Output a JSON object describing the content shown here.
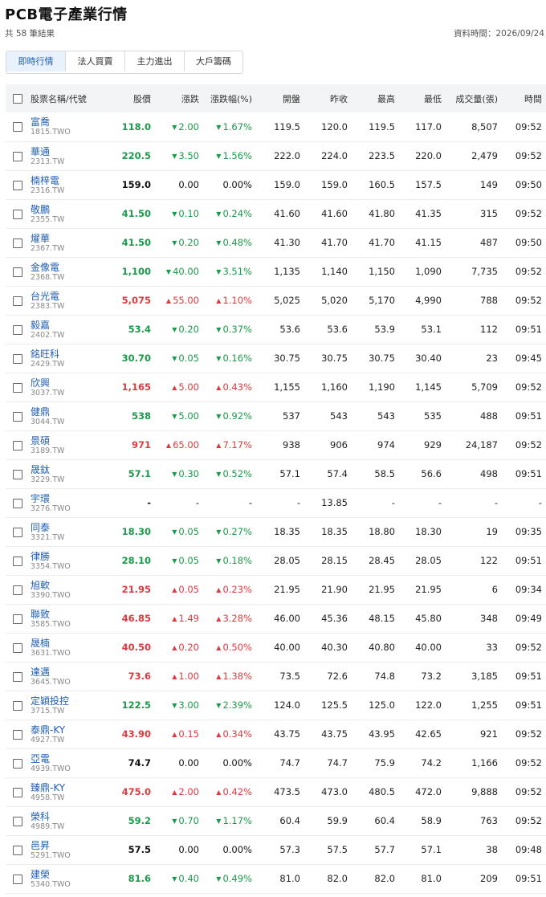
{
  "header": {
    "title": "PCB電子產業行情",
    "result_count": "共 58 筆結果",
    "data_time": "資料時間：2026/09/24"
  },
  "tabs": [
    {
      "label": "即時行情",
      "active": true
    },
    {
      "label": "法人買賣",
      "active": false
    },
    {
      "label": "主力進出",
      "active": false
    },
    {
      "label": "大戶籌碼",
      "active": false
    }
  ],
  "table": {
    "columns": [
      "股票名稱/代號",
      "股價",
      "漲跌",
      "漲跌幅(%)",
      "開盤",
      "昨收",
      "最高",
      "最低",
      "成交量(張)",
      "時間"
    ],
    "rows": [
      {
        "name": "富喬",
        "code": "1815.TWO",
        "price": "118.0",
        "change": "2.00",
        "pct": "1.67%",
        "open": "119.5",
        "prev": "120.0",
        "high": "119.5",
        "low": "117.0",
        "volume": "8,507",
        "time": "09:52",
        "dir": "down"
      },
      {
        "name": "華通",
        "code": "2313.TW",
        "price": "220.5",
        "change": "3.50",
        "pct": "1.56%",
        "open": "222.0",
        "prev": "224.0",
        "high": "223.5",
        "low": "220.0",
        "volume": "2,479",
        "time": "09:52",
        "dir": "down"
      },
      {
        "name": "楠梓電",
        "code": "2316.TW",
        "price": "159.0",
        "change": "0.00",
        "pct": "0.00%",
        "open": "159.0",
        "prev": "159.0",
        "high": "160.5",
        "low": "157.5",
        "volume": "149",
        "time": "09:50",
        "dir": "flat"
      },
      {
        "name": "敬鵬",
        "code": "2355.TW",
        "price": "41.50",
        "change": "0.10",
        "pct": "0.24%",
        "open": "41.60",
        "prev": "41.60",
        "high": "41.80",
        "low": "41.35",
        "volume": "315",
        "time": "09:52",
        "dir": "down"
      },
      {
        "name": "燿華",
        "code": "2367.TW",
        "price": "41.50",
        "change": "0.20",
        "pct": "0.48%",
        "open": "41.30",
        "prev": "41.70",
        "high": "41.70",
        "low": "41.15",
        "volume": "487",
        "time": "09:50",
        "dir": "down"
      },
      {
        "name": "金像電",
        "code": "2368.TW",
        "price": "1,100",
        "change": "40.00",
        "pct": "3.51%",
        "open": "1,135",
        "prev": "1,140",
        "high": "1,150",
        "low": "1,090",
        "volume": "7,735",
        "time": "09:52",
        "dir": "down"
      },
      {
        "name": "台光電",
        "code": "2383.TW",
        "price": "5,075",
        "change": "55.00",
        "pct": "1.10%",
        "open": "5,025",
        "prev": "5,020",
        "high": "5,170",
        "low": "4,990",
        "volume": "788",
        "time": "09:52",
        "dir": "up"
      },
      {
        "name": "毅嘉",
        "code": "2402.TW",
        "price": "53.4",
        "change": "0.20",
        "pct": "0.37%",
        "open": "53.6",
        "prev": "53.6",
        "high": "53.9",
        "low": "53.1",
        "volume": "112",
        "time": "09:51",
        "dir": "down"
      },
      {
        "name": "銘旺科",
        "code": "2429.TW",
        "price": "30.70",
        "change": "0.05",
        "pct": "0.16%",
        "open": "30.75",
        "prev": "30.75",
        "high": "30.75",
        "low": "30.40",
        "volume": "23",
        "time": "09:45",
        "dir": "down"
      },
      {
        "name": "欣興",
        "code": "3037.TW",
        "price": "1,165",
        "change": "5.00",
        "pct": "0.43%",
        "open": "1,155",
        "prev": "1,160",
        "high": "1,190",
        "low": "1,145",
        "volume": "5,709",
        "time": "09:52",
        "dir": "up"
      },
      {
        "name": "健鼎",
        "code": "3044.TW",
        "price": "538",
        "change": "5.00",
        "pct": "0.92%",
        "open": "537",
        "prev": "543",
        "high": "543",
        "low": "535",
        "volume": "488",
        "time": "09:51",
        "dir": "down"
      },
      {
        "name": "景碩",
        "code": "3189.TW",
        "price": "971",
        "change": "65.00",
        "pct": "7.17%",
        "open": "938",
        "prev": "906",
        "high": "974",
        "low": "929",
        "volume": "24,187",
        "time": "09:52",
        "dir": "up"
      },
      {
        "name": "晟鈦",
        "code": "3229.TW",
        "price": "57.1",
        "change": "0.30",
        "pct": "0.52%",
        "open": "57.1",
        "prev": "57.4",
        "high": "58.5",
        "low": "56.6",
        "volume": "498",
        "time": "09:51",
        "dir": "down"
      },
      {
        "name": "宇環",
        "code": "3276.TWO",
        "price": "-",
        "change": "-",
        "pct": "-",
        "open": "-",
        "prev": "13.85",
        "high": "-",
        "low": "-",
        "volume": "-",
        "time": "-",
        "dir": "none"
      },
      {
        "name": "同泰",
        "code": "3321.TW",
        "price": "18.30",
        "change": "0.05",
        "pct": "0.27%",
        "open": "18.35",
        "prev": "18.35",
        "high": "18.80",
        "low": "18.30",
        "volume": "19",
        "time": "09:35",
        "dir": "down"
      },
      {
        "name": "律勝",
        "code": "3354.TWO",
        "price": "28.10",
        "change": "0.05",
        "pct": "0.18%",
        "open": "28.05",
        "prev": "28.15",
        "high": "28.45",
        "low": "28.05",
        "volume": "122",
        "time": "09:51",
        "dir": "down"
      },
      {
        "name": "旭軟",
        "code": "3390.TWO",
        "price": "21.95",
        "change": "0.05",
        "pct": "0.23%",
        "open": "21.95",
        "prev": "21.90",
        "high": "21.95",
        "low": "21.95",
        "volume": "6",
        "time": "09:34",
        "dir": "up"
      },
      {
        "name": "聯致",
        "code": "3585.TWO",
        "price": "46.85",
        "change": "1.49",
        "pct": "3.28%",
        "open": "46.00",
        "prev": "45.36",
        "high": "48.15",
        "low": "45.80",
        "volume": "348",
        "time": "09:49",
        "dir": "up"
      },
      {
        "name": "晟楠",
        "code": "3631.TWO",
        "price": "40.50",
        "change": "0.20",
        "pct": "0.50%",
        "open": "40.00",
        "prev": "40.30",
        "high": "40.80",
        "low": "40.00",
        "volume": "33",
        "time": "09:52",
        "dir": "up"
      },
      {
        "name": "達邁",
        "code": "3645.TWO",
        "price": "73.6",
        "change": "1.00",
        "pct": "1.38%",
        "open": "73.5",
        "prev": "72.6",
        "high": "74.8",
        "low": "73.2",
        "volume": "3,185",
        "time": "09:51",
        "dir": "up"
      },
      {
        "name": "定穎投控",
        "code": "3715.TW",
        "price": "122.5",
        "change": "3.00",
        "pct": "2.39%",
        "open": "124.0",
        "prev": "125.5",
        "high": "125.0",
        "low": "122.0",
        "volume": "1,255",
        "time": "09:51",
        "dir": "down"
      },
      {
        "name": "泰鼎-KY",
        "code": "4927.TW",
        "price": "43.90",
        "change": "0.15",
        "pct": "0.34%",
        "open": "43.75",
        "prev": "43.75",
        "high": "43.95",
        "low": "42.65",
        "volume": "921",
        "time": "09:52",
        "dir": "up"
      },
      {
        "name": "亞電",
        "code": "4939.TWO",
        "price": "74.7",
        "change": "0.00",
        "pct": "0.00%",
        "open": "74.7",
        "prev": "74.7",
        "high": "75.9",
        "low": "74.2",
        "volume": "1,166",
        "time": "09:52",
        "dir": "flat"
      },
      {
        "name": "臻鼎-KY",
        "code": "4958.TW",
        "price": "475.0",
        "change": "2.00",
        "pct": "0.42%",
        "open": "473.5",
        "prev": "473.0",
        "high": "480.5",
        "low": "472.0",
        "volume": "9,888",
        "time": "09:52",
        "dir": "up"
      },
      {
        "name": "榮科",
        "code": "4989.TW",
        "price": "59.2",
        "change": "0.70",
        "pct": "1.17%",
        "open": "60.4",
        "prev": "59.9",
        "high": "60.4",
        "low": "58.9",
        "volume": "763",
        "time": "09:52",
        "dir": "down"
      },
      {
        "name": "邑昇",
        "code": "5291.TWO",
        "price": "57.5",
        "change": "0.00",
        "pct": "0.00%",
        "open": "57.3",
        "prev": "57.5",
        "high": "57.7",
        "low": "57.1",
        "volume": "38",
        "time": "09:48",
        "dir": "flat"
      },
      {
        "name": "建榮",
        "code": "5340.TWO",
        "price": "81.6",
        "change": "0.40",
        "pct": "0.49%",
        "open": "81.0",
        "prev": "82.0",
        "high": "82.0",
        "low": "81.0",
        "volume": "209",
        "time": "09:51",
        "dir": "down"
      }
    ]
  },
  "colors": {
    "up": "#e0393e",
    "down": "#1a9a4a",
    "link": "#1f5fb4",
    "active_tab_bg": "#e8f1fc"
  },
  "icons": {
    "up_arrow": "▲",
    "down_arrow": "▼"
  }
}
